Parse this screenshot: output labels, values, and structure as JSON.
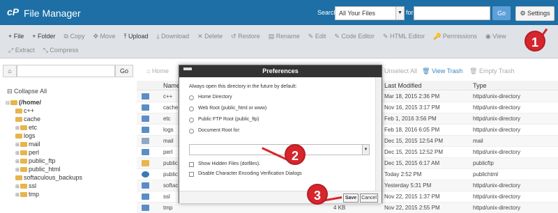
{
  "header": {
    "title": "File Manager",
    "search_label": "Search",
    "search_scope": "All Your Files",
    "for_label": "for",
    "go_label": "Go",
    "settings_label": "Settings"
  },
  "toolbar": {
    "row1": [
      {
        "label": "+ File",
        "active": true
      },
      {
        "label": "+ Folder",
        "active": true
      },
      {
        "label": "Copy",
        "active": false
      },
      {
        "label": "Move",
        "active": false
      },
      {
        "label": "Upload",
        "active": true
      },
      {
        "label": "Download",
        "active": false
      },
      {
        "label": "Delete",
        "active": false
      },
      {
        "label": "Restore",
        "active": false
      },
      {
        "label": "Rename",
        "active": false
      },
      {
        "label": "Edit",
        "active": false
      },
      {
        "label": "Code Editor",
        "active": false
      },
      {
        "label": "HTML Editor",
        "active": false
      },
      {
        "label": "Permissions",
        "active": false
      },
      {
        "label": "View",
        "active": false
      }
    ],
    "row2": [
      {
        "label": "Extract",
        "active": false
      },
      {
        "label": "Compress",
        "active": false
      }
    ]
  },
  "sidebar": {
    "go_label": "Go",
    "collapse_label": "Collapse All",
    "root": "(/home/",
    "items": [
      "c++",
      "cache",
      "etc",
      "logs",
      "mail",
      "perl",
      "public_ftp",
      "public_html",
      "softaculous_backups",
      "ssl",
      "tmp"
    ]
  },
  "main": {
    "home_label": "Home",
    "unselect_label": "Unselect All",
    "view_trash_label": "View Trash",
    "empty_trash_label": "Empty Trash",
    "columns": [
      "Name",
      "Last Modified",
      "Type"
    ],
    "rows": [
      {
        "name": "c++",
        "modified": "Mar 18, 2015 2:36 PM",
        "type": "httpd/unix-directory"
      },
      {
        "name": "cache",
        "modified": "Nov 16, 2015 3:17 PM",
        "type": "httpd/unix-directory"
      },
      {
        "name": "etc",
        "modified": "Feb 1, 2016 3:56 PM",
        "type": "httpd/unix-directory"
      },
      {
        "name": "logs",
        "modified": "Feb 18, 2016 6:05 PM",
        "type": "httpd/unix-directory"
      },
      {
        "name": "mail",
        "modified": "Dec 15, 2015 12:54 PM",
        "type": "mail"
      },
      {
        "name": "perl",
        "modified": "Dec 15, 2015 12:52 PM",
        "type": "httpd/unix-directory"
      },
      {
        "name": "public",
        "modified": "Dec 15, 2015 6:17 AM",
        "type": "publicftp"
      },
      {
        "name": "public",
        "modified": "Today 2:52 PM",
        "type": "publichtml"
      },
      {
        "name": "softac",
        "modified": "Yesterday 5:31 PM",
        "type": "httpd/unix-directory"
      },
      {
        "name": "ssl",
        "modified": "Nov 22, 2015 1:37 PM",
        "type": "httpd/unix-directory"
      },
      {
        "name": "tmp",
        "size": "4 KB",
        "modified": "Nov 22, 2015 2:55 PM",
        "type": "httpd/unix-directory"
      }
    ]
  },
  "modal": {
    "title": "Preferences",
    "intro": "Always open this directory in the future by default:",
    "options": [
      "Home Directory",
      "Web Root (public_html or www)",
      "Public FTP Root (public_ftp)",
      "Document Root for:"
    ],
    "show_hidden": "Show Hidden Files (dotfiles).",
    "disable_encoding": "Disable Character Encoding Verification Dialogs",
    "save_label": "Save",
    "cancel_label": "Cancel"
  },
  "annotations": [
    "1",
    "2",
    "3"
  ],
  "colors": {
    "header_bg": "#1d6fa6",
    "annotation": "#d6262d",
    "folder": "#e7b54b"
  }
}
